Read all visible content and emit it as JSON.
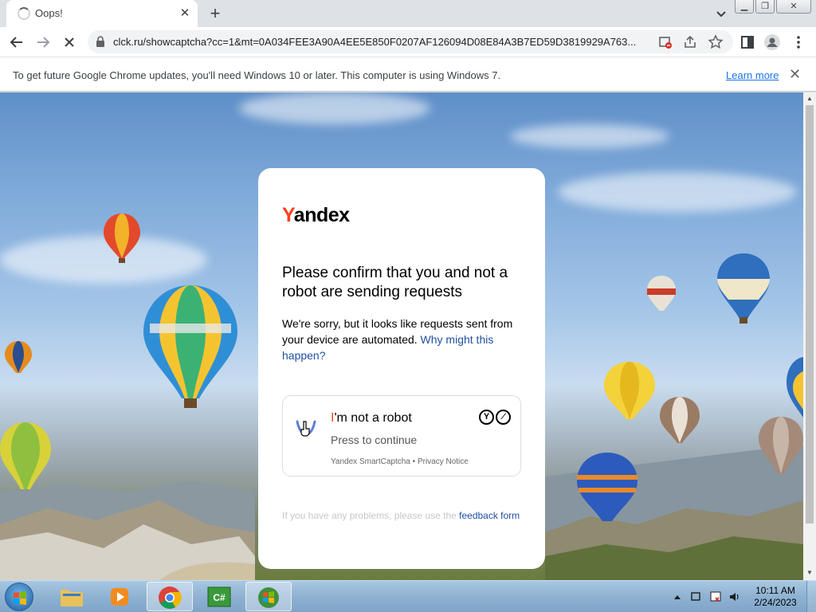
{
  "browser": {
    "tab_title": "Oops!",
    "url": "clck.ru/showcaptcha?cc=1&mt=0A034FEE3A90A4EE5E850F0207AF126094D08E84A3B7ED59D3819929A763...",
    "infobar_message": "To get future Google Chrome updates, you'll need Windows 10 or later. This computer is using Windows 7.",
    "infobar_link": "Learn more",
    "icons": [
      "back-icon",
      "forward-icon",
      "stop-loading-icon",
      "lock-icon",
      "blocked-popup-icon",
      "share-icon",
      "bookmark-star-icon",
      "side-panel-icon",
      "profile-icon",
      "menu-icon"
    ]
  },
  "captcha": {
    "logo_first": "Y",
    "logo_rest": "andex",
    "heading": "Please confirm that you and not a robot are sending requests",
    "description": "We're sorry, but it looks like requests sent from your device are automated.",
    "why_link": "Why might this happen?",
    "checkbox_title_first": "I",
    "checkbox_title_rest": "'m not a robot",
    "checkbox_subtitle": "Press to continue",
    "footer_brand": "Yandex SmartCaptcha",
    "footer_separator": " • ",
    "footer_privacy": "Privacy Notice",
    "feedback_text": "If you have any problems, please use the ",
    "feedback_link": "feedback form",
    "brand_color": "#fc3f1d",
    "link_color": "#1f4fa3"
  },
  "taskbar": {
    "apps": [
      "windows-explorer",
      "media-player",
      "google-chrome",
      "csharp-editor",
      "windows-app"
    ],
    "time": "10:11 AM",
    "date": "2/24/2023"
  }
}
